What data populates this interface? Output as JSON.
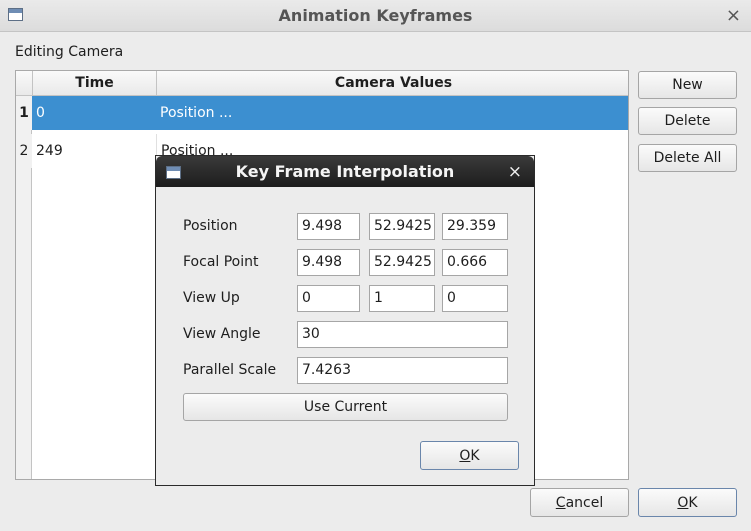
{
  "window": {
    "title": "Animation Keyframes",
    "close_glyph": "×",
    "icon": "window-icon"
  },
  "section_label": "Editing Camera",
  "table": {
    "columns": [
      "Time",
      "Camera Values"
    ],
    "rows": [
      {
        "num": "1",
        "time": "0",
        "values": "Position ...",
        "selected": true
      },
      {
        "num": "2",
        "time": "249",
        "values": "Position ...",
        "selected": false
      }
    ]
  },
  "side_buttons": {
    "new": "New",
    "delete": "Delete",
    "delete_all": "Delete All"
  },
  "footer": {
    "cancel_prefix": "",
    "cancel_mnemonic": "C",
    "cancel_rest": "ancel",
    "ok_mnemonic": "O",
    "ok_rest": "K"
  },
  "dialog": {
    "title": "Key Frame Interpolation",
    "close_glyph": "×",
    "labels": {
      "position": "Position",
      "focal_point": "Focal Point",
      "view_up": "View Up",
      "view_angle": "View Angle",
      "parallel_scale": "Parallel Scale"
    },
    "position": [
      "9.498",
      "52.9425",
      "29.359"
    ],
    "focal_point": [
      "9.498",
      "52.9425",
      "0.666"
    ],
    "view_up": [
      "0",
      "1",
      "0"
    ],
    "view_angle": "30",
    "parallel_scale": "7.4263",
    "use_current": "Use Current",
    "ok_mnemonic": "O",
    "ok_rest": "K"
  },
  "colors": {
    "selection": "#3c8fd0",
    "dialog_titlebar": "#1d1d1d"
  }
}
